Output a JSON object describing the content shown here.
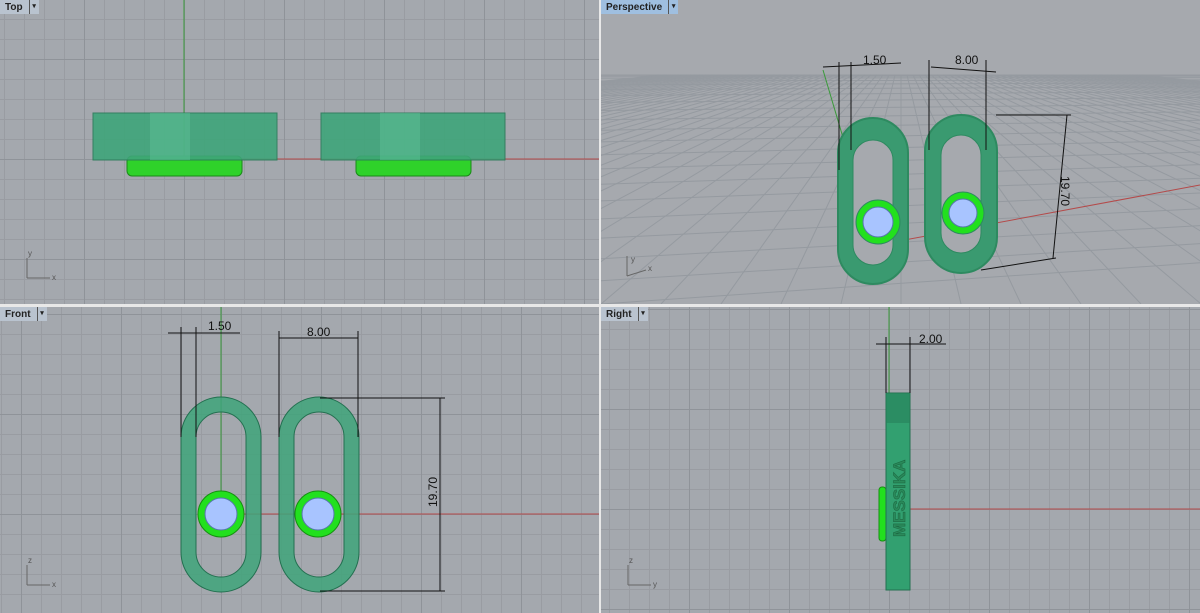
{
  "viewports": {
    "top": {
      "label": "Top",
      "axes": {
        "x": "x",
        "y": "y"
      }
    },
    "perspective": {
      "label": "Perspective",
      "dims": {
        "gap": "1.50",
        "width": "8.00",
        "height": "19.70"
      },
      "axes": {
        "x": "x",
        "y": "y"
      }
    },
    "front": {
      "label": "Front",
      "dims": {
        "gap": "1.50",
        "width": "8.00",
        "height": "19.70"
      },
      "axes": {
        "x": "x",
        "z": "z"
      }
    },
    "right": {
      "label": "Right",
      "dims": {
        "thickness": "2.00"
      },
      "engraving": "MESSIKA",
      "axes": {
        "y": "y",
        "z": "z"
      }
    }
  },
  "dropdown_icon": "▾",
  "colors": {
    "ring": "#2e9a6a",
    "stone_rim": "#22e01e",
    "stone": "#a8c4ff",
    "x_axis": "#b44a4a",
    "y_axis": "#3a9a3a"
  }
}
